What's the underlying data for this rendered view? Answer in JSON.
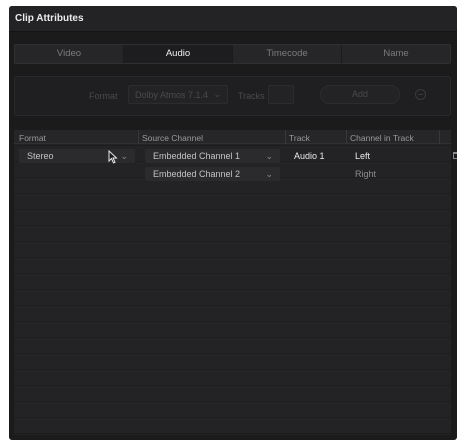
{
  "window": {
    "title": "Clip Attributes"
  },
  "tabs": [
    {
      "label": "Video",
      "active": false
    },
    {
      "label": "Audio",
      "active": true
    },
    {
      "label": "Timecode",
      "active": false
    },
    {
      "label": "Name",
      "active": false
    }
  ],
  "format_bar": {
    "format_label": "Format",
    "format_value": "Dolby Atmos 7.1.4",
    "tracks_label": "Tracks",
    "add_label": "Add"
  },
  "table": {
    "headers": [
      "Format",
      "Source Channel",
      "Track",
      "Channel in Track"
    ],
    "rows": [
      {
        "format": "Stereo",
        "source_channel": "Embedded Channel 1",
        "track": "Audio 1",
        "channel_in_track": "Left"
      },
      {
        "format": "",
        "source_channel": "Embedded Channel 2",
        "track": "",
        "channel_in_track": "Right"
      }
    ]
  },
  "icons": {
    "dropdown": "chevron-down-icon",
    "delete": "trash-icon",
    "remove": "minus-circle-icon",
    "pointer": "mouse-pointer-icon"
  }
}
